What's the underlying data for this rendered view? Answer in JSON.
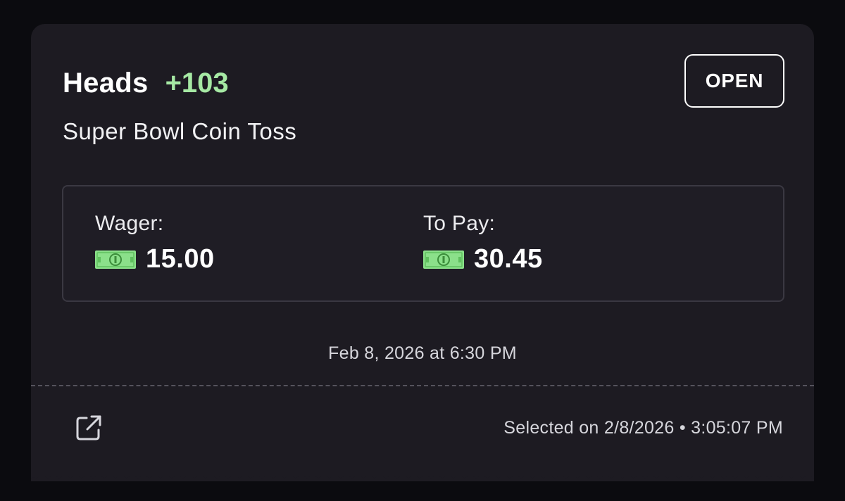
{
  "bet": {
    "selection": "Heads",
    "odds": "+103",
    "event": "Super Bowl Coin Toss",
    "status": "OPEN"
  },
  "amounts": {
    "wager_label": "Wager:",
    "wager_value": "15.00",
    "topay_label": "To Pay:",
    "topay_value": "30.45",
    "currency_icon": "cash-icon"
  },
  "event_time": "Feb 8, 2026 at 6:30 PM",
  "footer": {
    "share_icon": "share-icon",
    "selected_on": "Selected on 2/8/2026 • 3:05:07 PM"
  },
  "colors": {
    "background": "#0b0b0f",
    "card": "#1d1b22",
    "odds_green": "#a6e9a4",
    "cash_green": "#8be08a"
  }
}
